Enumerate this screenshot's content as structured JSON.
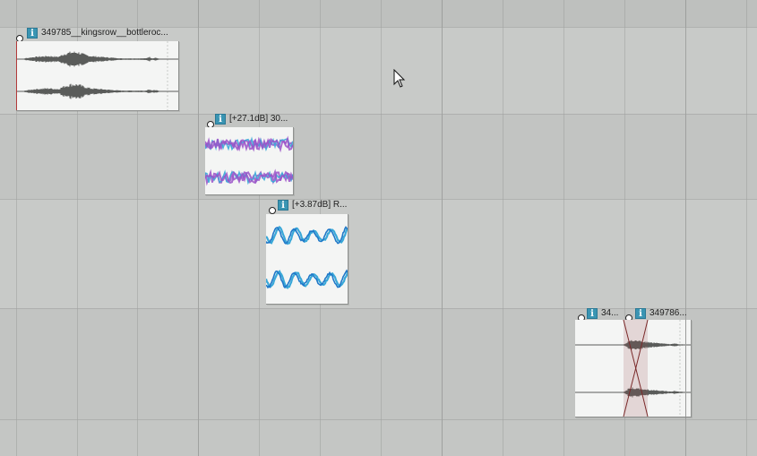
{
  "clips": [
    {
      "id": "clip-1",
      "title": "349785__kingsrow__bottleroc...",
      "waveform": "gray"
    },
    {
      "id": "clip-2",
      "title": "[+27.1dB] 30...",
      "waveform": "purple-cyan"
    },
    {
      "id": "clip-3",
      "title": "[+3.87dB] R...",
      "waveform": "blue"
    },
    {
      "id": "clip-4a",
      "title": "34...",
      "waveform": "gray"
    },
    {
      "id": "clip-4b",
      "title": "349786...",
      "waveform": "gray"
    }
  ],
  "icons": {
    "info": "info-icon",
    "pointer": "mouse-cursor-icon"
  },
  "info_glyph": "i",
  "colors": {
    "info_icon": "#3a95b3",
    "wave_gray": "#5a5c5a",
    "wave_purple": "#9a52c8",
    "wave_cyan": "#3aa8d8",
    "wave_blue": "#1f78c8",
    "crossfade": "#7a2a2a"
  }
}
